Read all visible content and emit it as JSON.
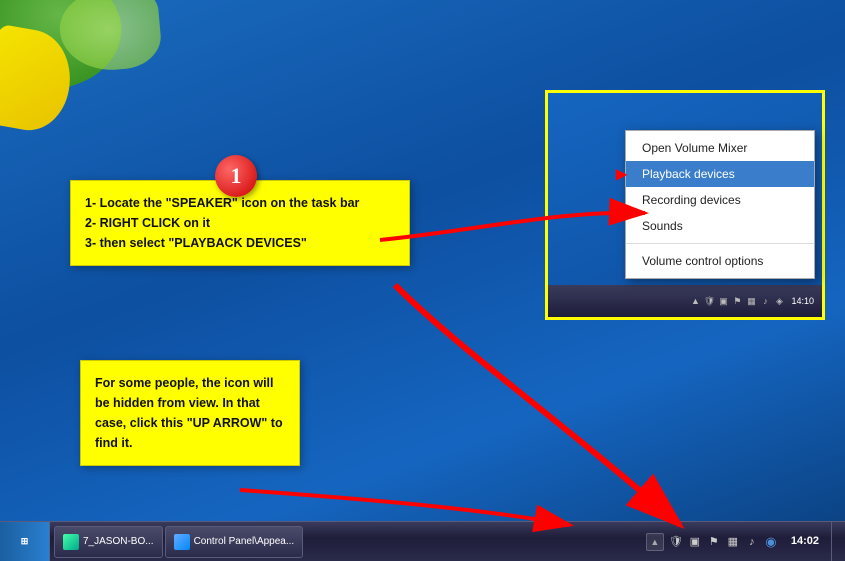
{
  "desktop": {
    "background_description": "Windows 7 Aero blue desktop"
  },
  "note1": {
    "step": "1",
    "line1": "1- Locate the \"SPEAKER\" icon on the task bar",
    "line2": "2- RIGHT CLICK on it",
    "line3": "3- then select \"PLAYBACK DEVICES\""
  },
  "note2": {
    "text": "For some people, the icon will be hidden from view. In that case, click this \"UP ARROW\" to find it."
  },
  "context_menu": {
    "items": [
      {
        "label": "Open Volume Mixer",
        "highlighted": false
      },
      {
        "label": "Playback devices",
        "highlighted": true
      },
      {
        "label": "Recording devices",
        "highlighted": false
      },
      {
        "label": "Sounds",
        "highlighted": false
      },
      {
        "label": "Volume control options",
        "highlighted": false
      }
    ]
  },
  "taskbar": {
    "btn1_label": "7_JASON-BO...",
    "btn2_label": "Control Panel\\Appea...",
    "clock_time": "14:02",
    "mini_clock": "14:10"
  }
}
